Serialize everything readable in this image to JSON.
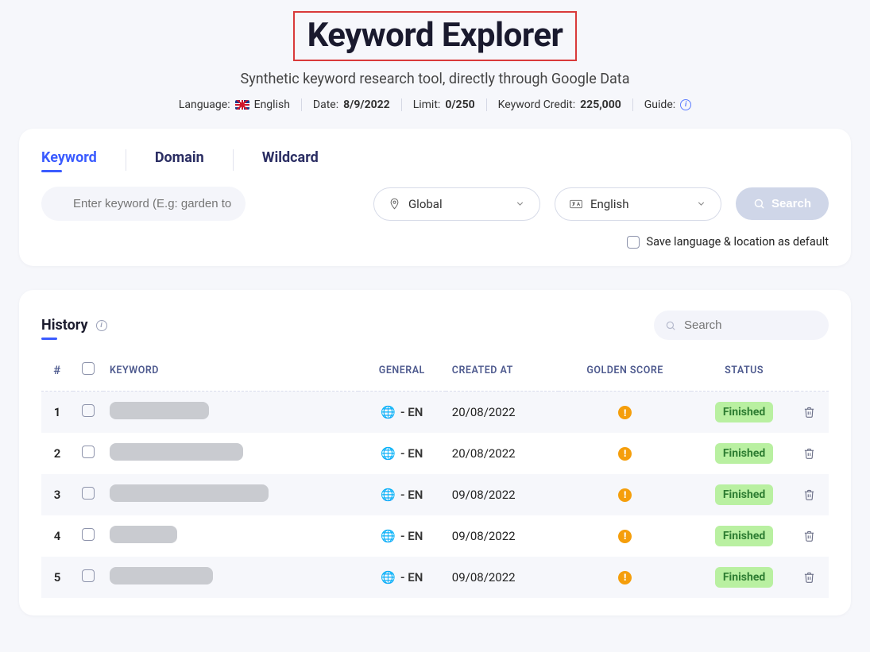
{
  "header": {
    "title": "Keyword Explorer",
    "subtitle": "Synthetic keyword research tool, directly through Google Data",
    "language_label": "Language:",
    "language_value": "English",
    "date_label": "Date:",
    "date_value": "8/9/2022",
    "limit_label": "Limit:",
    "limit_value": "0/250",
    "credit_label": "Keyword Credit:",
    "credit_value": "225,000",
    "guide_label": "Guide:"
  },
  "search_card": {
    "tabs": {
      "keyword": "Keyword",
      "domain": "Domain",
      "wildcard": "Wildcard"
    },
    "input_placeholder": "Enter keyword (E.g: garden tools)",
    "location_value": "Global",
    "language_value": "English",
    "search_button": "Search",
    "save_default_label": "Save language & location as default"
  },
  "history": {
    "title": "History",
    "search_placeholder": "Search",
    "columns": {
      "index": "#",
      "keyword": "KEYWORD",
      "general": "GENERAL",
      "created": "CREATED AT",
      "golden": "GOLDEN SCORE",
      "status": "STATUS"
    },
    "rows": [
      {
        "idx": "1",
        "pill_w": 125,
        "general": " - EN",
        "created": "20/08/2022",
        "status": "Finished"
      },
      {
        "idx": "2",
        "pill_w": 168,
        "general": " - EN",
        "created": "20/08/2022",
        "status": "Finished"
      },
      {
        "idx": "3",
        "pill_w": 200,
        "general": " - EN",
        "created": "09/08/2022",
        "status": "Finished"
      },
      {
        "idx": "4",
        "pill_w": 85,
        "general": " - EN",
        "created": "09/08/2022",
        "status": "Finished"
      },
      {
        "idx": "5",
        "pill_w": 130,
        "general": " - EN",
        "created": "09/08/2022",
        "status": "Finished"
      }
    ]
  }
}
